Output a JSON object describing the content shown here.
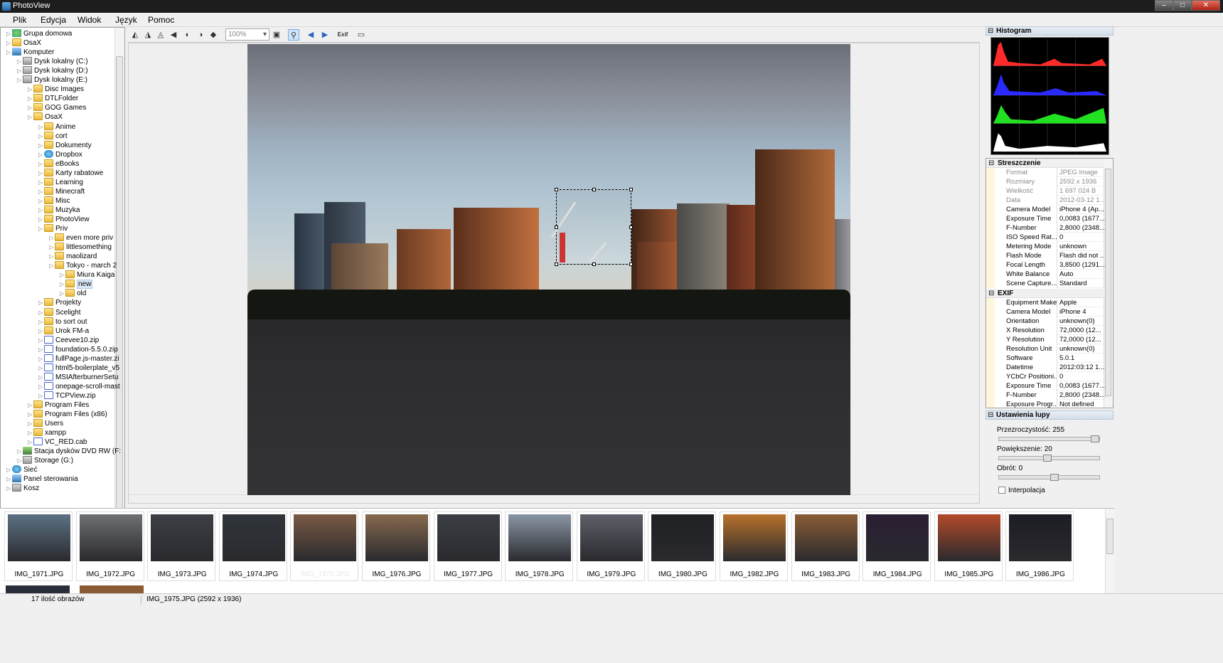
{
  "window": {
    "title": "PhotoView"
  },
  "menu": [
    "Plik",
    "Edycja",
    "Widok",
    "Język",
    "Pomoc"
  ],
  "tree": [
    {
      "label": "Grupa domowa",
      "depth": 0,
      "icon": "home-icon"
    },
    {
      "label": "OsaX",
      "depth": 0,
      "icon": "folder-icon"
    },
    {
      "label": "Komputer",
      "depth": 0,
      "icon": "computer-icon"
    },
    {
      "label": "Dysk lokalny (C:)",
      "depth": 1,
      "icon": "drive-icon"
    },
    {
      "label": "Dysk lokalny (D:)",
      "depth": 1,
      "icon": "drive-icon"
    },
    {
      "label": "Dysk lokalny (E:)",
      "depth": 1,
      "icon": "drive-icon"
    },
    {
      "label": "Disc Images",
      "depth": 2,
      "icon": "folder-icon"
    },
    {
      "label": "DTLFolder",
      "depth": 2,
      "icon": "folder-icon"
    },
    {
      "label": "GOG Games",
      "depth": 2,
      "icon": "folder-icon"
    },
    {
      "label": "OsaX",
      "depth": 2,
      "icon": "folder-icon"
    },
    {
      "label": "Anime",
      "depth": 3,
      "icon": "folder-icon"
    },
    {
      "label": "cort",
      "depth": 3,
      "icon": "folder-icon"
    },
    {
      "label": "Dokumenty",
      "depth": 3,
      "icon": "folder-icon"
    },
    {
      "label": "Dropbox",
      "depth": 3,
      "icon": "dropbox-icon"
    },
    {
      "label": "eBooks",
      "depth": 3,
      "icon": "folder-icon"
    },
    {
      "label": "Karty rabatowe",
      "depth": 3,
      "icon": "folder-icon"
    },
    {
      "label": "Learning",
      "depth": 3,
      "icon": "folder-icon"
    },
    {
      "label": "Minecraft",
      "depth": 3,
      "icon": "folder-icon"
    },
    {
      "label": "Misc",
      "depth": 3,
      "icon": "folder-icon"
    },
    {
      "label": "Muzyka",
      "depth": 3,
      "icon": "folder-icon"
    },
    {
      "label": "PhotoView",
      "depth": 3,
      "icon": "folder-icon"
    },
    {
      "label": "Priv",
      "depth": 3,
      "icon": "folder-icon"
    },
    {
      "label": "even more priv",
      "depth": 4,
      "icon": "folder-icon"
    },
    {
      "label": "littlesomething",
      "depth": 4,
      "icon": "folder-icon"
    },
    {
      "label": "maolizard",
      "depth": 4,
      "icon": "folder-icon"
    },
    {
      "label": "Tokyo - march 2",
      "depth": 4,
      "icon": "folder-icon"
    },
    {
      "label": "Miura Kaiga",
      "depth": 5,
      "icon": "folder-icon"
    },
    {
      "label": "new",
      "depth": 5,
      "icon": "folder-icon",
      "selected": true
    },
    {
      "label": "old",
      "depth": 5,
      "icon": "folder-icon"
    },
    {
      "label": "Projekty",
      "depth": 3,
      "icon": "folder-icon"
    },
    {
      "label": "Scelight",
      "depth": 3,
      "icon": "folder-icon"
    },
    {
      "label": "to sort out",
      "depth": 3,
      "icon": "folder-icon"
    },
    {
      "label": "Urok FM-a",
      "depth": 3,
      "icon": "folder-icon"
    },
    {
      "label": "Ceevee10.zip",
      "depth": 3,
      "icon": "zip-icon"
    },
    {
      "label": "foundation-5.5.0.zip",
      "depth": 3,
      "icon": "zip-icon"
    },
    {
      "label": "fullPage.js-master.zi",
      "depth": 3,
      "icon": "zip-icon"
    },
    {
      "label": "html5-boilerplate_v5",
      "depth": 3,
      "icon": "zip-icon"
    },
    {
      "label": "MSIAfterburnerSetu",
      "depth": 3,
      "icon": "zip-icon"
    },
    {
      "label": "onepage-scroll-mast",
      "depth": 3,
      "icon": "zip-icon"
    },
    {
      "label": "TCPView.zip",
      "depth": 3,
      "icon": "zip-icon"
    },
    {
      "label": "Program Files",
      "depth": 2,
      "icon": "folder-icon"
    },
    {
      "label": "Program Files (x86)",
      "depth": 2,
      "icon": "folder-icon"
    },
    {
      "label": "Users",
      "depth": 2,
      "icon": "folder-icon"
    },
    {
      "label": "xampp",
      "depth": 2,
      "icon": "folder-icon"
    },
    {
      "label": "VC_RED.cab",
      "depth": 2,
      "icon": "zip-icon"
    },
    {
      "label": "Stacja dysków DVD RW (F:",
      "depth": 1,
      "icon": "dvd-icon"
    },
    {
      "label": "Storage (G:)",
      "depth": 1,
      "icon": "drive-icon"
    },
    {
      "label": "Sieć",
      "depth": 0,
      "icon": "network-icon"
    },
    {
      "label": "Panel sterowania",
      "depth": 0,
      "icon": "control-panel-icon"
    },
    {
      "label": "Kosz",
      "depth": 0,
      "icon": "recycle-bin-icon"
    }
  ],
  "toolbar": {
    "zoom": "100%",
    "exif_label": "Exif"
  },
  "panels": {
    "histogram": "Histogram",
    "summary": "Streszczenie",
    "exif": "EXIF",
    "magnifier": "Ustawienia lupy"
  },
  "summary_rows": [
    {
      "k": "Format",
      "v": "JPEG Image",
      "dim": true
    },
    {
      "k": "Rozmiary",
      "v": "2592 x 1936",
      "dim": true
    },
    {
      "k": "Wielkość",
      "v": "1 697 024 B",
      "dim": true
    },
    {
      "k": "Data",
      "v": "2012-03-12 1...",
      "dim": true
    },
    {
      "k": "Camera Model",
      "v": "iPhone 4 (Ap..."
    },
    {
      "k": "Exposure Time",
      "v": "0,0083 (1677..."
    },
    {
      "k": "F-Number",
      "v": "2,8000 (2348..."
    },
    {
      "k": "ISO Speed Rat...",
      "v": "0"
    },
    {
      "k": "Metering Mode",
      "v": "unknown"
    },
    {
      "k": "Flash Mode",
      "v": "Flash did not ..."
    },
    {
      "k": "Focal Length",
      "v": "3,8500 (1291..."
    },
    {
      "k": "White Balance",
      "v": "Auto"
    },
    {
      "k": "Scene Capture...",
      "v": "Standard"
    }
  ],
  "exif_rows": [
    {
      "k": "Equipment Make",
      "v": "Apple"
    },
    {
      "k": "Camera Model",
      "v": "iPhone 4"
    },
    {
      "k": "Orientation",
      "v": "unknown(0)"
    },
    {
      "k": "X Resolution",
      "v": "72,0000 (12..."
    },
    {
      "k": "Y Resolution",
      "v": "72,0000 (12..."
    },
    {
      "k": "Resolution Unit",
      "v": "unknown(0)"
    },
    {
      "k": "Software",
      "v": "5.0.1"
    },
    {
      "k": "Datetime",
      "v": "2012:03:12 1..."
    },
    {
      "k": "YCbCr Positioni...",
      "v": "0"
    },
    {
      "k": "Exposure Time",
      "v": "0,0083 (1677..."
    },
    {
      "k": "F-Number",
      "v": "2,8000 (2348..."
    },
    {
      "k": "Exposure Progr...",
      "v": "Not defined"
    }
  ],
  "magnifier": {
    "opacity_label": "Przezroczystość: 255",
    "opacity": 1.0,
    "zoom_label": "Powiększenie: 20",
    "zoom": 0.48,
    "rotation_label": "Obrót: 0",
    "rotation": 0.56,
    "interpolation_label": "Interpolacja",
    "interpolation": false
  },
  "thumbnails": [
    {
      "name": "IMG_1971.JPG",
      "tone": "#5c7183"
    },
    {
      "name": "IMG_1972.JPG",
      "tone": "#6e7074"
    },
    {
      "name": "IMG_1973.JPG",
      "tone": "#3c3f44"
    },
    {
      "name": "IMG_1974.JPG",
      "tone": "#30353a"
    },
    {
      "name": "IMG_1975.JPG",
      "tone": "#7a5a44",
      "selected": true
    },
    {
      "name": "IMG_1976.JPG",
      "tone": "#86694e"
    },
    {
      "name": "IMG_1977.JPG",
      "tone": "#3b3f44"
    },
    {
      "name": "IMG_1978.JPG",
      "tone": "#8a96a6"
    },
    {
      "name": "IMG_1979.JPG",
      "tone": "#5d6069"
    },
    {
      "name": "IMG_1980.JPG",
      "tone": "#1e2024"
    },
    {
      "name": "IMG_1982.JPG",
      "tone": "#b8722c"
    },
    {
      "name": "IMG_1983.JPG",
      "tone": "#8a5d36"
    },
    {
      "name": "IMG_1984.JPG",
      "tone": "#2a1e33"
    },
    {
      "name": "IMG_1985.JPG",
      "tone": "#b34a2a"
    },
    {
      "name": "IMG_1986.JPG",
      "tone": "#1c1c24"
    }
  ],
  "status": {
    "count": "17 ilość obrazów",
    "current": "IMG_1975.JPG (2592 x 1936)"
  }
}
